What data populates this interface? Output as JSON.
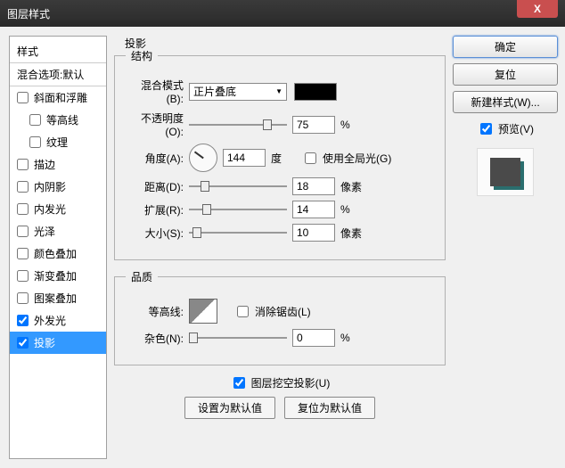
{
  "window": {
    "title": "图层样式",
    "close": "X"
  },
  "left": {
    "header": "样式",
    "blend_options": "混合选项:默认",
    "items": [
      {
        "label": "斜面和浮雕",
        "checked": false,
        "indent": 0
      },
      {
        "label": "等高线",
        "checked": false,
        "indent": 1
      },
      {
        "label": "纹理",
        "checked": false,
        "indent": 1
      },
      {
        "label": "描边",
        "checked": false,
        "indent": 0
      },
      {
        "label": "内阴影",
        "checked": false,
        "indent": 0
      },
      {
        "label": "内发光",
        "checked": false,
        "indent": 0
      },
      {
        "label": "光泽",
        "checked": false,
        "indent": 0
      },
      {
        "label": "颜色叠加",
        "checked": false,
        "indent": 0
      },
      {
        "label": "渐变叠加",
        "checked": false,
        "indent": 0
      },
      {
        "label": "图案叠加",
        "checked": false,
        "indent": 0
      },
      {
        "label": "外发光",
        "checked": true,
        "indent": 0
      },
      {
        "label": "投影",
        "checked": true,
        "indent": 0,
        "selected": true
      }
    ]
  },
  "center": {
    "panel_title": "投影",
    "structure": {
      "legend": "结构",
      "blend_mode_label": "混合模式(B):",
      "blend_mode_value": "正片叠底",
      "opacity_label": "不透明度(O):",
      "opacity_value": "75",
      "opacity_unit": "%",
      "opacity_pct": 75,
      "angle_label": "角度(A):",
      "angle_value": "144",
      "angle_unit": "度",
      "global_light_label": "使用全局光(G)",
      "global_light_checked": false,
      "distance_label": "距离(D):",
      "distance_value": "18",
      "distance_unit": "像素",
      "distance_pct": 12,
      "spread_label": "扩展(R):",
      "spread_value": "14",
      "spread_unit": "%",
      "spread_pct": 14,
      "size_label": "大小(S):",
      "size_value": "10",
      "size_unit": "像素",
      "size_pct": 4
    },
    "quality": {
      "legend": "品质",
      "contour_label": "等高线:",
      "antialias_label": "消除锯齿(L)",
      "antialias_checked": false,
      "noise_label": "杂色(N):",
      "noise_value": "0",
      "noise_unit": "%",
      "noise_pct": 0
    },
    "knockout_label": "图层挖空投影(U)",
    "knockout_checked": true,
    "set_default": "设置为默认值",
    "reset_default": "复位为默认值"
  },
  "right": {
    "ok": "确定",
    "cancel": "复位",
    "new_style": "新建样式(W)...",
    "preview_label": "预览(V)",
    "preview_checked": true
  },
  "chart_data": null
}
